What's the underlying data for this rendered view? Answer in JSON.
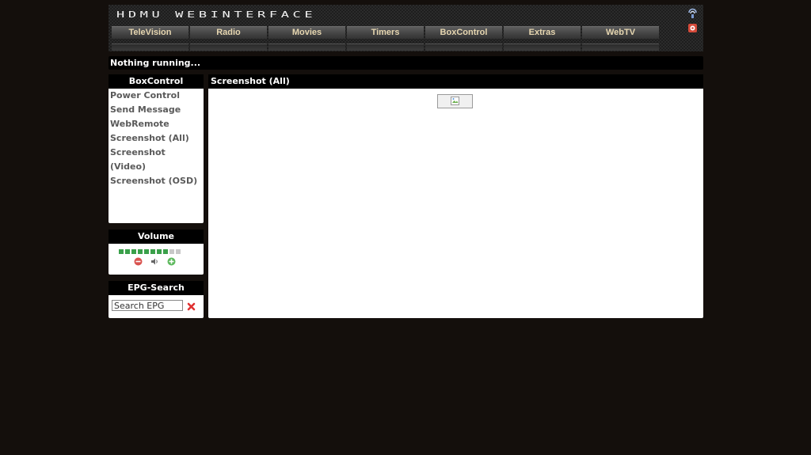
{
  "header": {
    "logo_text": "HDMU WEBINTERFACE",
    "nav_items": [
      "TeleVision",
      "Radio",
      "Movies",
      "Timers",
      "BoxControl",
      "Extras",
      "WebTV"
    ],
    "icons": [
      "stream-icon",
      "settings-icon"
    ]
  },
  "status": {
    "text": "Nothing running..."
  },
  "sidebar": {
    "boxcontrol": {
      "title": "BoxControl",
      "items": [
        "Power Control",
        "Send Message",
        "WebRemote",
        "Screenshot (All)",
        "Screenshot (Video)",
        "Screenshot (OSD)"
      ]
    },
    "volume": {
      "title": "Volume",
      "level": 8,
      "max": 10,
      "active_color": "#3aa04a",
      "inactive_color": "#c8c8c8"
    },
    "epg_search": {
      "title": "EPG-Search",
      "input_value": "Search EPG"
    }
  },
  "main": {
    "title": "Screenshot (All)",
    "image_state": "broken-image"
  }
}
